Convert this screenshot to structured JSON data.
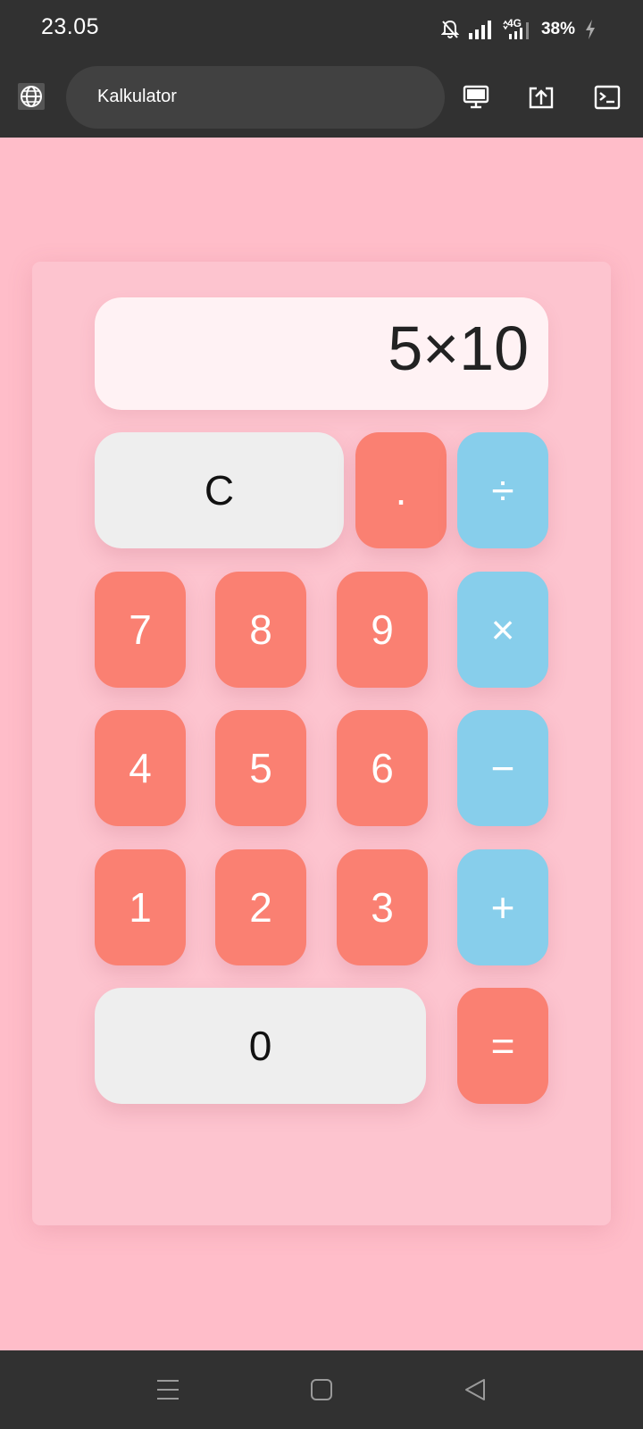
{
  "status_bar": {
    "time": "23.05",
    "network": "4G",
    "battery": "38%"
  },
  "app_bar": {
    "title": "Kalkulator"
  },
  "calculator": {
    "display": "5×10",
    "keys": {
      "clear": "C",
      "dot": ".",
      "divide": "÷",
      "seven": "7",
      "eight": "8",
      "nine": "9",
      "multiply": "×",
      "four": "4",
      "five": "5",
      "six": "6",
      "minus": "−",
      "one": "1",
      "two": "2",
      "three": "3",
      "plus": "+",
      "zero": "0",
      "equals": "="
    }
  },
  "colors": {
    "page_background": "#ffbdc9",
    "card_background": "#fdc4cf",
    "digit_key": "#fa8072",
    "operator_key": "#87ceeb",
    "light_key": "#eeeeee",
    "display_background": "#fff2f4",
    "system_bar": "#313131"
  },
  "icons": {
    "status": [
      "bell-off-icon",
      "signal-icon",
      "network-4g-icon",
      "battery-charging-icon"
    ],
    "app_bar": [
      "globe-icon",
      "desktop-icon",
      "share-icon",
      "terminal-icon"
    ],
    "navigation": [
      "menu-icon",
      "home-icon",
      "back-icon"
    ]
  }
}
